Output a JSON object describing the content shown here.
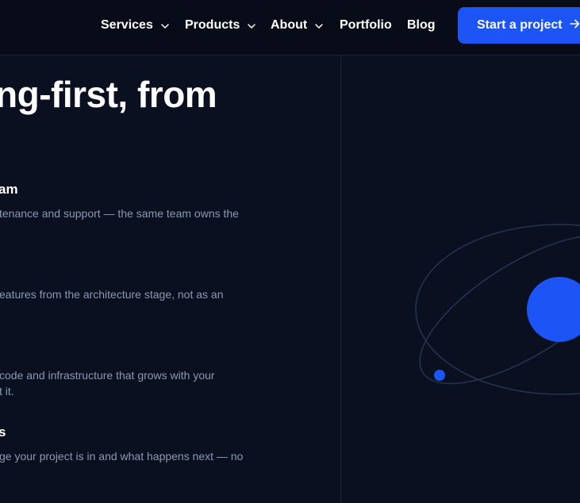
{
  "nav": {
    "items": [
      {
        "label": "Services",
        "dropdown": true
      },
      {
        "label": "Products",
        "dropdown": true
      },
      {
        "label": "About",
        "dropdown": true
      },
      {
        "label": "Portfolio",
        "dropdown": false
      },
      {
        "label": "Blog",
        "dropdown": false
      }
    ],
    "cta_label": "Start a project"
  },
  "hero": {
    "headline_fragment": "ng-first, from"
  },
  "features": [
    {
      "title": "am",
      "lines": [
        "tenance and support — the same team owns the"
      ]
    },
    {
      "title": "",
      "lines": [
        "eatures from the architecture stage, not as an"
      ]
    },
    {
      "title": "",
      "lines": [
        "code and infrastructure that grows with your",
        "t it."
      ]
    },
    {
      "title": "s",
      "lines": [
        "ge your project is in and what happens next — no"
      ]
    }
  ],
  "colors": {
    "background": "#0a1020",
    "navbar": "#070c18",
    "accent": "#1d54f5",
    "body_text": "#8b98b4",
    "orbit_line": "#26324f"
  },
  "icons": {
    "dropdown": "chevron-down-icon",
    "cta": "arrow-right-icon"
  }
}
